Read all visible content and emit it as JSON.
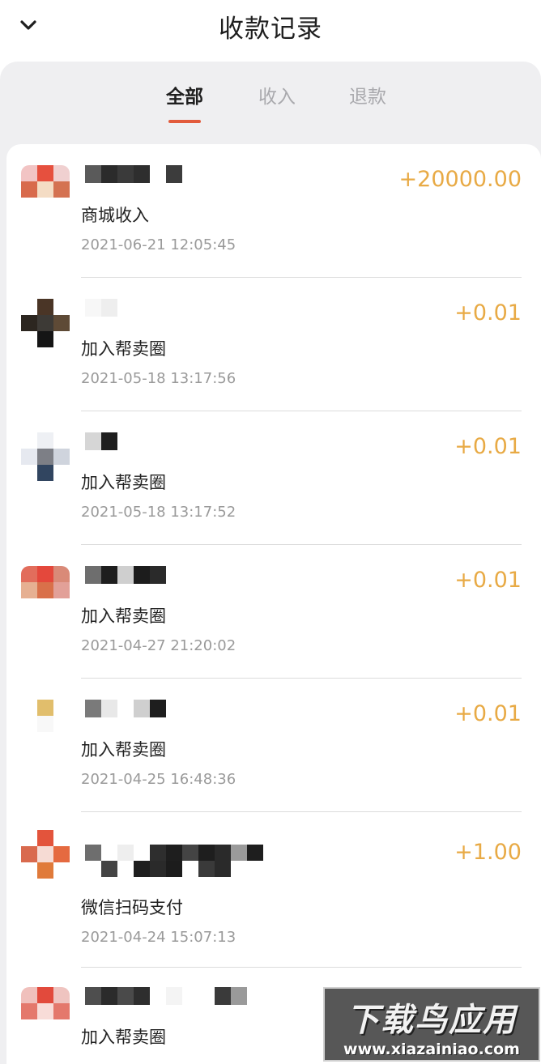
{
  "header": {
    "title": "收款记录",
    "back_icon": "chevron-down-icon"
  },
  "tabs": [
    {
      "label": "全部",
      "active": true
    },
    {
      "label": "收入",
      "active": false
    },
    {
      "label": "退款",
      "active": false
    }
  ],
  "colors": {
    "accent": "#e25b3c",
    "amount": "#e8aa45",
    "page_bg": "#efeff1"
  },
  "records": [
    {
      "type": "商城收入",
      "time": "2021-06-21 12:05:45",
      "amount": "+20000.00"
    },
    {
      "type": "加入帮卖圈",
      "time": "2021-05-18 13:17:56",
      "amount": "+0.01"
    },
    {
      "type": "加入帮卖圈",
      "time": "2021-05-18 13:17:52",
      "amount": "+0.01"
    },
    {
      "type": "加入帮卖圈",
      "time": "2021-04-27 21:20:02",
      "amount": "+0.01"
    },
    {
      "type": "加入帮卖圈",
      "time": "2021-04-25 16:48:36",
      "amount": "+0.01"
    },
    {
      "type": "微信扫码支付",
      "time": "2021-04-24 15:07:13",
      "amount": "+1.00"
    },
    {
      "type": "加入帮卖圈",
      "time": "",
      "amount": ""
    }
  ],
  "watermark": {
    "title": "下载鸟应用",
    "url": "www.xiazainiao.com"
  }
}
